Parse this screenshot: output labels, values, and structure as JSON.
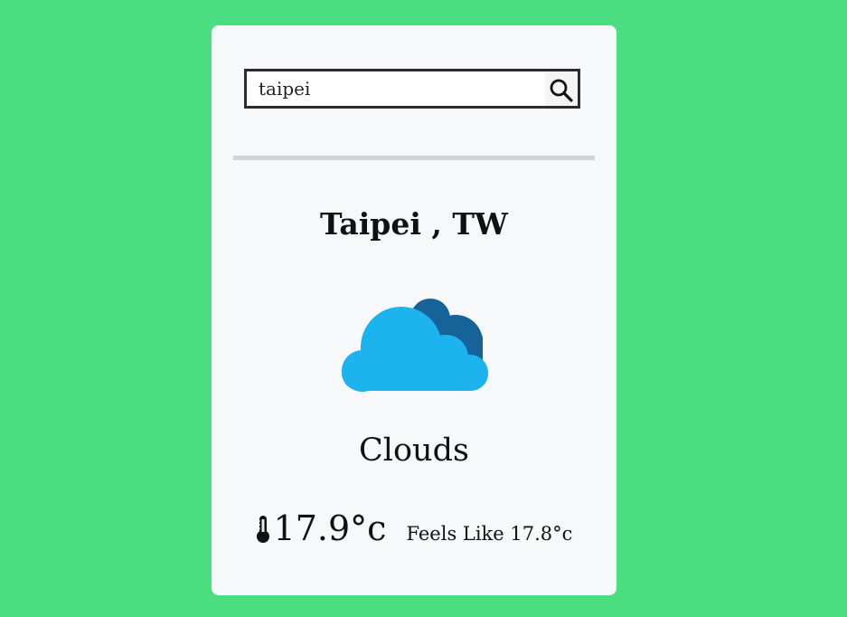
{
  "colors": {
    "page_background": "#4ade80",
    "card_background": "#f7f8fa",
    "cloud_front": "#1cb3ee",
    "cloud_back": "#156399"
  },
  "search": {
    "value": "taipei",
    "placeholder": "",
    "button_icon": "search-icon"
  },
  "weather": {
    "location": "Taipei , TW",
    "icon": "cloud-icon",
    "condition": "Clouds",
    "temperature": "17.9",
    "temperature_unit": "°c",
    "temperature_icon": "thermometer-icon",
    "feels_like_label": "Feels Like",
    "feels_like_value": "17.8°c"
  }
}
